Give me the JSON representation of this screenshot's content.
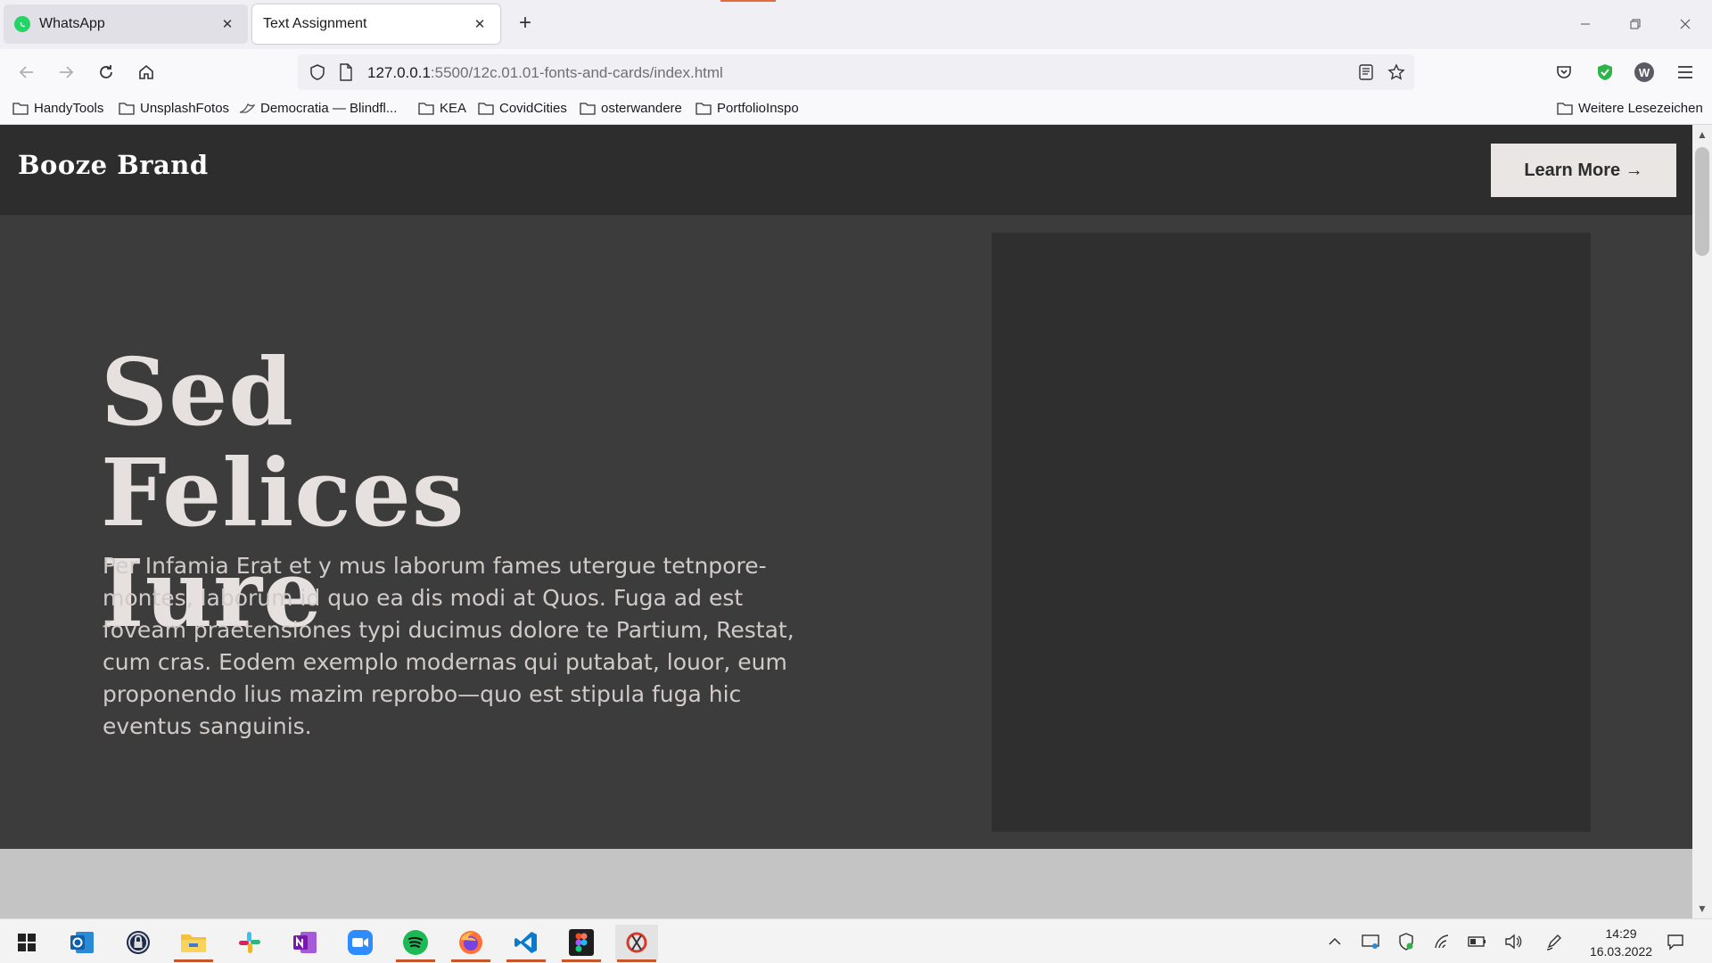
{
  "browser": {
    "tabs": [
      {
        "label": "WhatsApp",
        "active": false,
        "icon": "whatsapp-icon"
      },
      {
        "label": "Text Assignment",
        "active": true,
        "icon": ""
      }
    ],
    "url": {
      "host": "127.0.0.1",
      "path": ":5500/12c.01.01-fonts-and-cards/index.html"
    },
    "bookmarks": [
      {
        "label": "HandyTools",
        "icon": "folder-icon"
      },
      {
        "label": "UnsplashFotos",
        "icon": "folder-icon"
      },
      {
        "label": "Democratia — Blindfl...",
        "icon": "bird-icon"
      },
      {
        "label": "KEA",
        "icon": "folder-icon"
      },
      {
        "label": "CovidCities",
        "icon": "folder-icon"
      },
      {
        "label": "osterwandere",
        "icon": "folder-icon"
      },
      {
        "label": "PortfolioInspo",
        "icon": "folder-icon"
      }
    ],
    "other_bookmarks": "Weitere Lesezeichen",
    "account_initial": "W"
  },
  "site": {
    "brand": "Booze Brand",
    "cta": "Learn More →",
    "headline_line1": "Sed Felices",
    "headline_line2": "Iure",
    "body": "Per Infamia Erat et y mus laborum fames utergue tetnpore-montes, laborum id quo ea dis modi at Quos. Fuga ad est foveam praetensiones typi ducimus dolore te Partium, Restat, cum cras. Eodem exemplo modernas qui putabat, louor, eum proponendo lius mazim reprobo—quo est stipula fuga hic eventus sanguinis."
  },
  "taskbar": {
    "apps": [
      "outlook-icon",
      "keepass-icon",
      "file-explorer-icon",
      "slack-icon",
      "onenote-icon",
      "zoom-icon",
      "spotify-icon",
      "firefox-icon",
      "vscode-icon",
      "figma-icon",
      "snipping-tool-icon"
    ],
    "time": "14:29",
    "date": "16.03.2022"
  },
  "colors": {
    "header_bg": "#2d2d2d",
    "hero_bg": "#3c3c3c",
    "image_placeholder": "#2f2f2f",
    "headline": "#e6e1df",
    "button_bg": "#e9e6e4"
  }
}
